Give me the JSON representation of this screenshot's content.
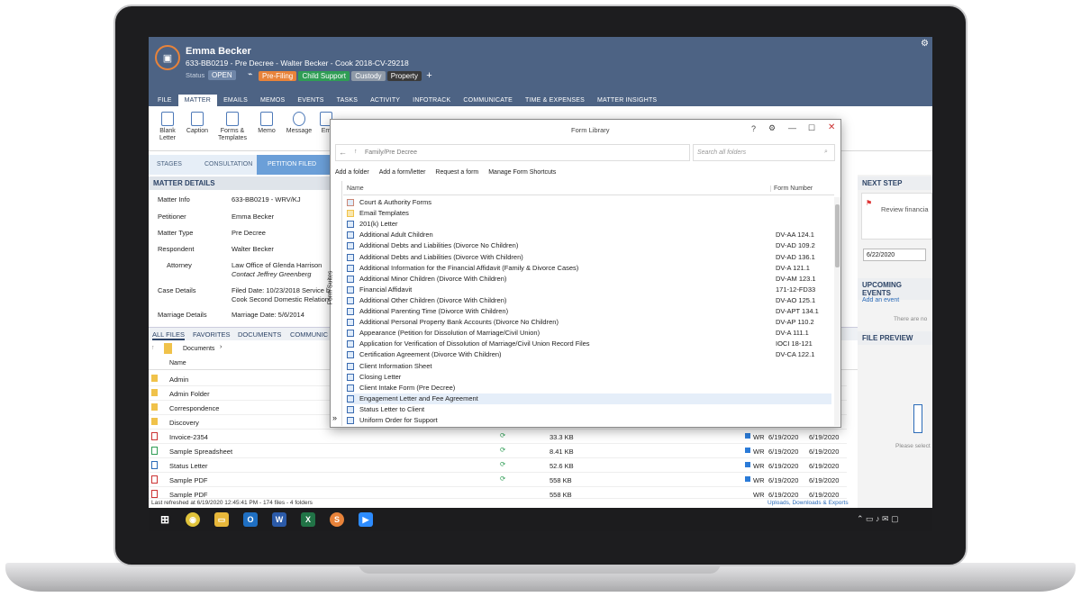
{
  "header": {
    "name": "Emma Becker",
    "matter": "633-BB0219 - Pre Decree - Walter Becker - Cook 2018-CV-29218",
    "status_label": "Status",
    "status": "OPEN",
    "tags": [
      {
        "label": "Pre-Filing",
        "color": "#e8833a"
      },
      {
        "label": "Child Support",
        "color": "#2f9d55"
      },
      {
        "label": "Custody",
        "color": "#8f9aa8"
      },
      {
        "label": "Property",
        "color": "#3a3a3a"
      }
    ],
    "add": "+"
  },
  "tabs": [
    "FILE",
    "MATTER",
    "EMAILS",
    "MEMOS",
    "EVENTS",
    "TASKS",
    "ACTIVITY",
    "INFOTRACK",
    "COMMUNICATE",
    "TIME & EXPENSES",
    "MATTER INSIGHTS"
  ],
  "ribbon": [
    "Blank Letter",
    "Caption",
    "Forms & Templates",
    "Memo",
    "Message",
    "Em"
  ],
  "stages": {
    "label": "STAGES",
    "s1": "CONSULTATION",
    "s2": "PETITION FILED"
  },
  "matter_details": {
    "title": "MATTER DETAILS",
    "rows": [
      {
        "k": "Matter Info",
        "v": "633-BB0219 - WRV/KJ"
      },
      {
        "k": "Petitioner",
        "v": "Emma Becker"
      },
      {
        "k": "Matter Type",
        "v": "Pre Decree"
      },
      {
        "k": "Respondent",
        "v": "Walter Becker"
      },
      {
        "k": "Attorney",
        "v": "Law Office of Glenda Harrison"
      },
      {
        "k": "Case Details",
        "v": "Filed Date: 10/23/2018  Service b"
      },
      {
        "k": "Marriage Details",
        "v": "Marriage Date: 5/6/2014"
      }
    ],
    "contact": "Contact Jeffrey Greenberg",
    "case_extra": "Cook Second Domestic Relations"
  },
  "files": {
    "tabs": [
      "ALL FILES",
      "FAVORITES",
      "DOCUMENTS",
      "COMMUNIC"
    ],
    "path": "Documents",
    "col": "Name",
    "items": [
      "Admin",
      "Admin Folder",
      "Correspondence",
      "Discovery",
      "Invoice-2354",
      "Sample Spreadsheet",
      "Status Letter",
      "Sample PDF",
      "Sample PDF"
    ],
    "sizes": [
      "33.3 KB",
      "8.41 KB",
      "52.6 KB",
      "558 KB",
      "558 KB"
    ],
    "by": "WR",
    "date": "6/19/2020",
    "status": "Last refreshed at 6/19/2020 12:45:41 PM  -  174 files  -  4 folders",
    "uploads": "Uploads, Downloads & Exports"
  },
  "dialog": {
    "title": "Form Library",
    "path": "Family/Pre Decree",
    "search": "Search all folders",
    "actions": [
      "Add a folder",
      "Add a form/letter",
      "Request a form",
      "Manage Form Shortcuts"
    ],
    "col_name": "Name",
    "col_num": "Form Number",
    "side": "Form Suites",
    "items": [
      {
        "n": "Court & Authority Forms",
        "f": ""
      },
      {
        "n": "Email Templates",
        "f": ""
      },
      {
        "n": "201(k) Letter",
        "f": ""
      },
      {
        "n": "Additional Adult Children",
        "f": "DV-AA 124.1"
      },
      {
        "n": "Additional Debts and Liabilities (Divorce No Children)",
        "f": "DV-AD 109.2"
      },
      {
        "n": "Additional Debts and Liabilities (Divorce With Children)",
        "f": "DV-AD 136.1"
      },
      {
        "n": "Additional Information for the Financial Affidavit (Family & Divorce Cases)",
        "f": "DV-A 121.1"
      },
      {
        "n": "Additional Minor Children (Divorce With Children)",
        "f": "DV-AM 123.1"
      },
      {
        "n": "Financial Affidavit",
        "f": "171-12-FD33"
      },
      {
        "n": "Additional Other Children (Divorce With Children)",
        "f": "DV-AO 125.1"
      },
      {
        "n": "Additional Parenting Time (Divorce With Children)",
        "f": "DV-APT 134.1"
      },
      {
        "n": "Additional Personal Property Bank Accounts (Divorce No Children)",
        "f": "DV-AP 110.2"
      },
      {
        "n": "Appearance (Petition for Dissolution of Marriage/Civil Union)",
        "f": "DV-A 111.1"
      },
      {
        "n": "Application for Verification of Dissolution of Marriage/Civil Union Record Files",
        "f": "IOCI 18-121"
      },
      {
        "n": "Certification Agreement (Divorce With Children)",
        "f": "DV-CA 122.1"
      },
      {
        "n": "Client Information Sheet",
        "f": ""
      },
      {
        "n": "Closing Letter",
        "f": ""
      },
      {
        "n": "Client Intake Form (Pre Decree)",
        "f": ""
      },
      {
        "n": "Engagement Letter and Fee Agreement",
        "f": ""
      },
      {
        "n": "Status Letter to Client",
        "f": ""
      },
      {
        "n": "Uniform Order for Support",
        "f": ""
      }
    ]
  },
  "right": {
    "next_step": "NEXT STEP",
    "review": "Review financia",
    "date": "6/22/2020",
    "upcoming": "UPCOMING EVENTS",
    "add_event": "Add an event",
    "none": "There are no",
    "preview": "FILE PREVIEW",
    "select": "Please select"
  },
  "colors": {
    "header": "#4d6384",
    "accent": "#e8833a"
  }
}
